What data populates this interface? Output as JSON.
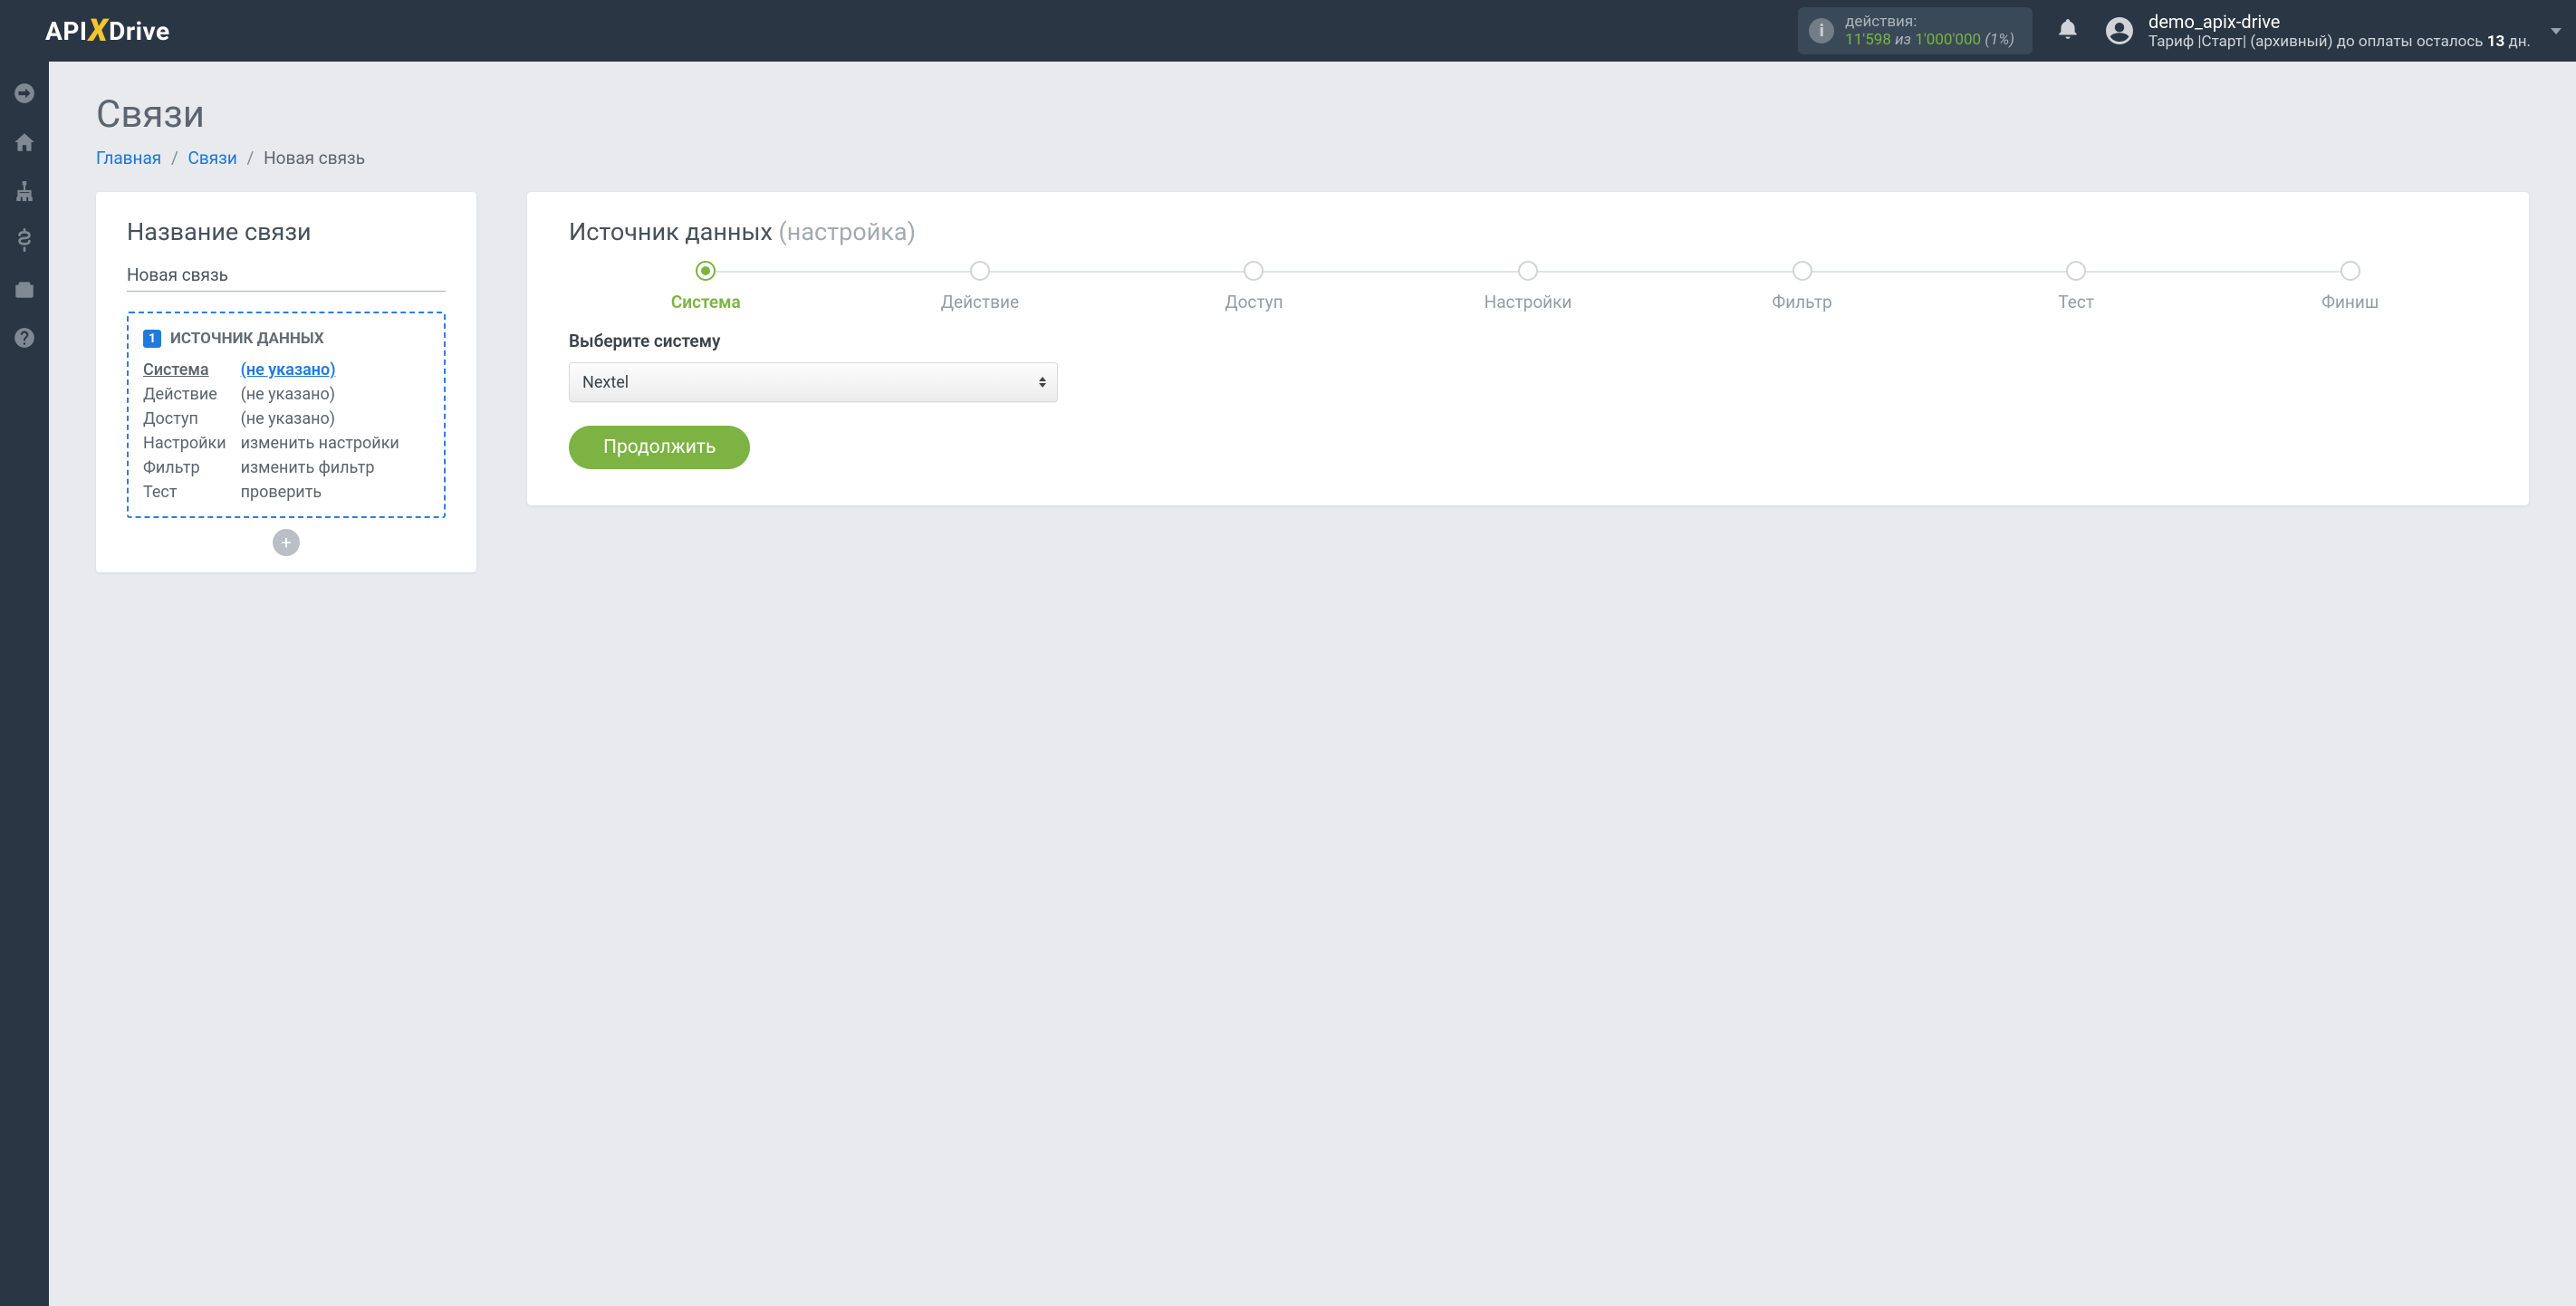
{
  "header": {
    "logo_api": "API",
    "logo_drive": "Drive",
    "actions_label": "действия:",
    "actions_used": "11'598",
    "actions_of": "из",
    "actions_total": "1'000'000",
    "actions_pct": "(1%)",
    "username": "demo_apix-drive",
    "tariff_prefix": "Тариф |Старт| (архивный) до оплаты осталось ",
    "tariff_days": "13",
    "tariff_suffix": " дн."
  },
  "page": {
    "title": "Связи",
    "breadcrumb": {
      "home": "Главная",
      "links": "Связи",
      "current": "Новая связь"
    }
  },
  "left_card": {
    "title": "Название связи",
    "name_value": "Новая связь",
    "source_badge": "1",
    "source_heading": "ИСТОЧНИК ДАННЫХ",
    "rows": [
      {
        "k": "Система",
        "v": "(не указано)",
        "active": true,
        "link": true
      },
      {
        "k": "Действие",
        "v": "(не указано)"
      },
      {
        "k": "Доступ",
        "v": "(не указано)"
      },
      {
        "k": "Настройки",
        "v": "изменить настройки"
      },
      {
        "k": "Фильтр",
        "v": "изменить фильтр"
      },
      {
        "k": "Тест",
        "v": "проверить"
      }
    ],
    "add_label": "+"
  },
  "right_card": {
    "title_main": "Источник данных ",
    "title_muted": "(настройка)",
    "steps": [
      "Система",
      "Действие",
      "Доступ",
      "Настройки",
      "Фильтр",
      "Тест",
      "Финиш"
    ],
    "active_step_index": 0,
    "field_label": "Выберите систему",
    "select_value": "Nextel",
    "continue_label": "Продолжить"
  }
}
